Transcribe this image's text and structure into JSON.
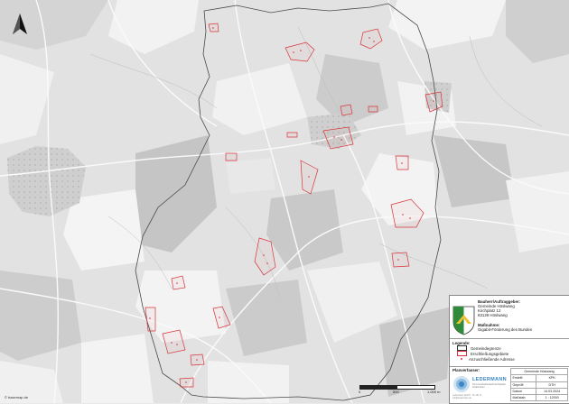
{
  "map": {
    "copyright": "© basemap.de",
    "north_label": "N",
    "scale": {
      "labels": [
        "0",
        "500",
        "1.000 m"
      ]
    },
    "colors": {
      "background": "#e9e9e9",
      "boundary": "#4a4a4a",
      "area_outline": "#d8343a",
      "address_point": "#d8343a",
      "forest": "#c7c7c7",
      "field": "#f7f7f7",
      "settlement": "#b8b8b8"
    }
  },
  "client": {
    "heading": "Bauherr/Auftraggeber:",
    "lines": [
      "Gemeinde Höslwang",
      "Kirchplatz 12",
      "83129 Höslwang"
    ]
  },
  "measure": {
    "heading": "Maßnahme:",
    "text": "Gigabit-Förderung des Bundes"
  },
  "legend": {
    "heading": "Legende:",
    "items": [
      {
        "type": "border",
        "label": "Gemeindegrenze"
      },
      {
        "type": "area",
        "label": "Erschließungsgebiete"
      },
      {
        "type": "point",
        "label": "Anzuschließende Adresse"
      }
    ]
  },
  "planner": {
    "heading": "Planverfasser:",
    "company": "LEDERMANN",
    "subtitle": "Kommunikationstechnik Digitale Infrastruktur",
    "address": "Ledermann GmbH · Tel. 08 71 · info@ledermann.de"
  },
  "info_table": {
    "title": "Gemeinde Höslwang",
    "rows": [
      {
        "label": "Erstellt",
        "value": "KPK"
      },
      {
        "label": "Geprüft",
        "value": "DTH"
      },
      {
        "label": "Datum",
        "value": "14.03.2024"
      },
      {
        "label": "Maßstab",
        "value": "1 : 12000"
      }
    ]
  }
}
